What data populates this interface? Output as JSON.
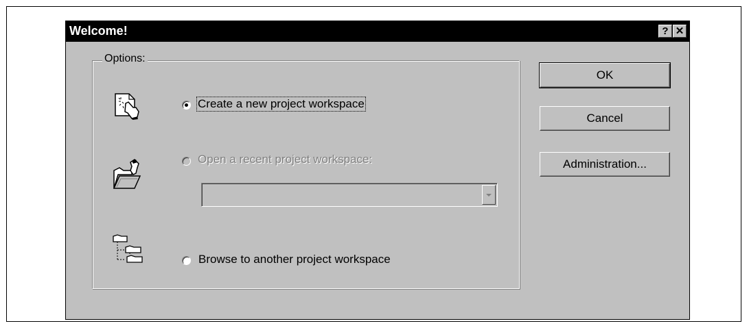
{
  "dialog": {
    "title": "Welcome!",
    "help_label": "?",
    "close_label": "✕"
  },
  "options": {
    "legend": "Options:",
    "create": {
      "label": "Create a new project workspace",
      "selected": true
    },
    "open_recent": {
      "label": "Open a recent project workspace:",
      "enabled": false,
      "value": ""
    },
    "browse": {
      "label": "Browse to another project workspace",
      "selected": false
    }
  },
  "buttons": {
    "ok": "OK",
    "cancel": "Cancel",
    "administration": "Administration..."
  },
  "icons": {
    "create": "new-project-hand-icon",
    "open": "open-folder-icon",
    "browse": "folder-tree-icon"
  }
}
